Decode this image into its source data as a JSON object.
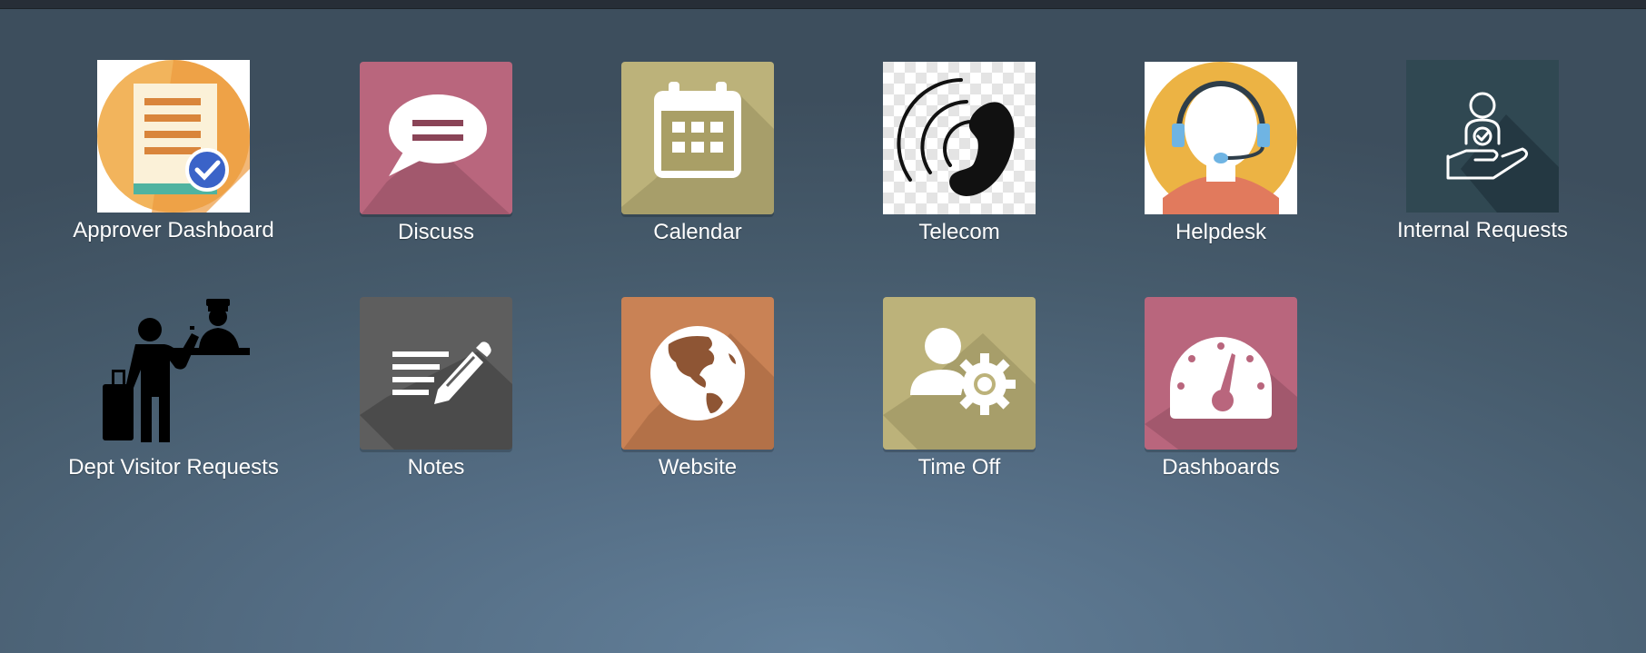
{
  "apps": [
    {
      "id": "approver-dashboard",
      "label": "Approver Dashboard",
      "icon": "clipboard-check-icon"
    },
    {
      "id": "discuss",
      "label": "Discuss",
      "icon": "chat-bubble-icon"
    },
    {
      "id": "calendar",
      "label": "Calendar",
      "icon": "calendar-icon"
    },
    {
      "id": "telecom",
      "label": "Telecom",
      "icon": "phone-icon"
    },
    {
      "id": "helpdesk",
      "label": "Helpdesk",
      "icon": "headset-agent-icon"
    },
    {
      "id": "internal-requests",
      "label": "Internal Requests",
      "icon": "hand-person-icon"
    },
    {
      "id": "dept-visitor-requests",
      "label": "Dept Visitor Requests",
      "icon": "visitor-reception-icon"
    },
    {
      "id": "notes",
      "label": "Notes",
      "icon": "note-pencil-icon"
    },
    {
      "id": "website",
      "label": "Website",
      "icon": "globe-icon"
    },
    {
      "id": "time-off",
      "label": "Time Off",
      "icon": "person-gear-icon"
    },
    {
      "id": "dashboards",
      "label": "Dashboards",
      "icon": "gauge-icon"
    }
  ],
  "colors": {
    "discuss": "#b9667d",
    "calendar": "#b9ad72",
    "notes": "#5b5b5b",
    "website": "#c37c52",
    "time_off": "#b9ad72",
    "dashboards": "#b9667d",
    "internal_requests": "#2f4751"
  }
}
